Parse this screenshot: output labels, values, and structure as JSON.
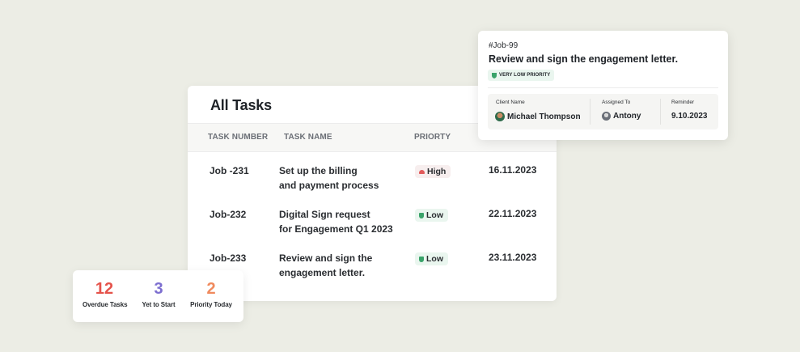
{
  "colors": {
    "background": "#ecede5",
    "high_priority": "#e25a5a",
    "low_priority": "#3aa36a",
    "overdue": "#e5534b",
    "yet_to_start": "#7d6fd0",
    "priority_today": "#f08a5d"
  },
  "tasks": {
    "title": "All Tasks",
    "columns": [
      "TASK NUMBER",
      "TASK NAME",
      "PRIORTY"
    ],
    "rows": [
      {
        "number": "Job -231",
        "name_line1": "Set up the billing",
        "name_line2": "and payment process",
        "priority": "High",
        "priority_icon": "flag-high-icon",
        "date": "16.11.2023"
      },
      {
        "number": "Job-232",
        "name_line1": "Digital Sign request",
        "name_line2": "for Engagement Q1 2023",
        "priority": "Low",
        "priority_icon": "shield-low-icon",
        "date": "22.11.2023"
      },
      {
        "number": "Job-233",
        "name_line1": "Review and sign the",
        "name_line2": "engagement letter.",
        "priority": "Low",
        "priority_icon": "shield-low-icon",
        "date": "23.11.2023"
      }
    ]
  },
  "job_detail": {
    "id": "#Job-99",
    "title": "Review and sign the engagement letter.",
    "badge": "VERY LOW PRIORITY",
    "badge_icon": "shield-icon",
    "client_label": "Client Name",
    "client_value": "Michael Thompson",
    "assigned_label": "Assigned To",
    "assigned_value": "Antony",
    "reminder_label": "Reminder",
    "reminder_value": "9.10.2023"
  },
  "stats": [
    {
      "value": "12",
      "label": "Overdue Tasks"
    },
    {
      "value": "3",
      "label": "Yet to Start"
    },
    {
      "value": "2",
      "label": "Priority Today"
    }
  ]
}
